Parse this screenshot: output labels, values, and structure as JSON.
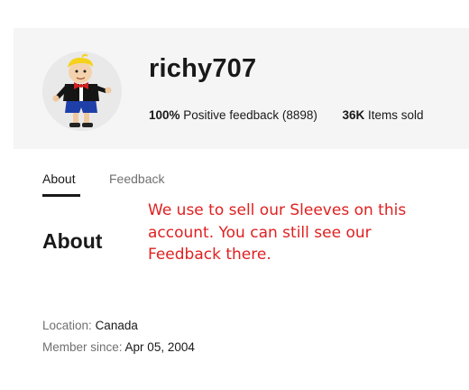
{
  "profile": {
    "username": "richy707",
    "feedback_percent": "100%",
    "feedback_text": "Positive feedback",
    "feedback_count": "(8898)",
    "items_sold_count": "36K",
    "items_sold_text": "Items sold",
    "avatar_icon": "cartoon-boy-avatar"
  },
  "tabs": [
    {
      "label": "About",
      "active": true
    },
    {
      "label": "Feedback",
      "active": false
    }
  ],
  "about": {
    "heading": "About",
    "note": "We use to sell our Sleeves on this account. You can still see our Feedback there.",
    "location_label": "Location:",
    "location_value": "Canada",
    "member_label": "Member since:",
    "member_value": "Apr 05, 2004"
  },
  "colors": {
    "header_bg": "#f5f5f5",
    "text": "#191919",
    "muted": "#707070",
    "note": "#e02020"
  }
}
